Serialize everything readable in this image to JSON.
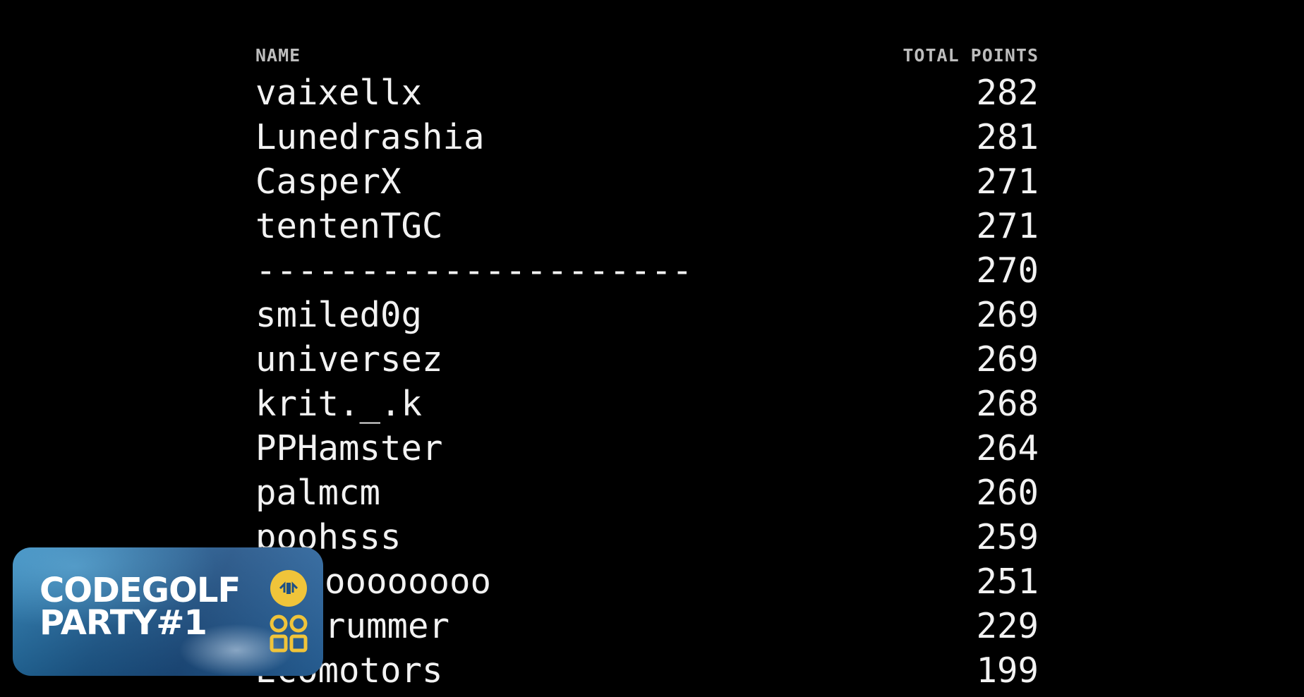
{
  "leaderboard": {
    "columns": {
      "name": "NAME",
      "points": "TOTAL POINTS"
    },
    "rows": [
      {
        "name": "vaixellx",
        "points": "282"
      },
      {
        "name": "Lunedrashia",
        "points": "281"
      },
      {
        "name": "CasperX",
        "points": "271"
      },
      {
        "name": "tentenTGC",
        "points": "271"
      },
      {
        "name": "---------------------",
        "points": "270"
      },
      {
        "name": "smiled0g",
        "points": "269"
      },
      {
        "name": "universez",
        "points": "269"
      },
      {
        "name": "krit._.k",
        "points": "268"
      },
      {
        "name": "PPHamster",
        "points": "264"
      },
      {
        "name": "palmcm",
        "points": "260"
      },
      {
        "name": "poohsss",
        "points": "259"
      },
      {
        "name": "oooooooo",
        "points": "251"
      },
      {
        "name": "rummer",
        "points": "229"
      },
      {
        "name": "Ecomotors",
        "points": "199"
      }
    ]
  },
  "badge": {
    "line1": "CODEGOLF",
    "line2": "PARTY#1",
    "icons": [
      "code-icon",
      "grid-icon"
    ],
    "icon_color": "#f0c43a"
  },
  "colors": {
    "background": "#000000",
    "text": "#f2f2f2",
    "header_text": "#bdbdbd"
  }
}
